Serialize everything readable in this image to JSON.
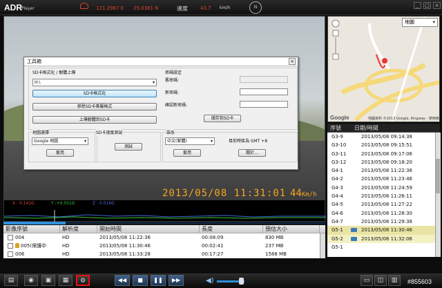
{
  "app": {
    "logo": "ADR",
    "logo_sub": "Player"
  },
  "status": {
    "longitude": "121.2967 E",
    "latitude": "25.0381 N",
    "speed_label": "速度",
    "speed_value": "43.7",
    "speed_unit": "km/h",
    "compass_label": "N"
  },
  "window_buttons": [
    "_",
    "□",
    "×"
  ],
  "video": {
    "timestamp": "2013/05/08  11:31:01",
    "speed": "44",
    "speed_unit": "Km/h"
  },
  "map": {
    "type_select": "地圖",
    "brand": "Google",
    "copyright": "地圖資料 ©2013 Google, Kingway - 使用條款"
  },
  "gps_list": {
    "headers": [
      "序號",
      "日期/時間"
    ],
    "rows": [
      {
        "id": "G3-9",
        "time": "2013/05/08 09:14:38"
      },
      {
        "id": "G3-10",
        "time": "2013/05/08 09:15:51"
      },
      {
        "id": "G3-11",
        "time": "2013/05/08 09:17:06"
      },
      {
        "id": "G3-12",
        "time": "2013/05/08 09:18:20"
      },
      {
        "id": "G4-1",
        "time": "2013/05/08 11:22:36"
      },
      {
        "id": "G4-2",
        "time": "2013/05/08 11:23:46"
      },
      {
        "id": "G4-3",
        "time": "2013/05/08 11:24:59"
      },
      {
        "id": "G4-4",
        "time": "2013/05/08 11:26:11"
      },
      {
        "id": "G4-5",
        "time": "2013/05/08 11:27:22"
      },
      {
        "id": "G4-6",
        "time": "2013/05/08 11:28:30"
      },
      {
        "id": "G4-7",
        "time": "2013/05/08 11:29:38"
      },
      {
        "id": "G5-1",
        "time": "2013/05/08 11:30:46"
      },
      {
        "id": "G5-2",
        "time": "2013/05/08 11:32:06"
      },
      {
        "id": "G5-1",
        "time": ""
      }
    ]
  },
  "gsensor": {
    "x": "X : 0.141G",
    "y": "Y :+0.031G",
    "z": "Z : 0.016G"
  },
  "files": {
    "headers": [
      "影像序號",
      "解析度",
      "開始時間",
      "長度",
      "預估大小"
    ],
    "rows": [
      {
        "id": "004",
        "res": "HD",
        "start": "2013/05/08 11:22:36",
        "len": "00:08:09",
        "size": "830 MB"
      },
      {
        "id": "005(保護中",
        "res": "HD",
        "start": "2013/05/08 11:30:46",
        "len": "00:02:41",
        "size": "237 MB"
      },
      {
        "id": "006",
        "res": "HD",
        "start": "2013/05/08 11:33:28",
        "len": "00:17:27",
        "size": "1588 MB"
      }
    ]
  },
  "controls": {
    "rewind": "◀◀",
    "stop": "■",
    "pause": "❚❚",
    "forward": "▶▶"
  },
  "watermark": "#855603",
  "dialog": {
    "title": "工具箱",
    "close": "×",
    "sd_section": "SD卡格式化 / 韌體上傳",
    "drive_select": "H:\\",
    "format_button": "SD卡格式化",
    "remove_button": "移除SD卡專屬格式",
    "upload_button": "上傳韌體到SD卡",
    "password_section": "密碼設定",
    "old_password": "舊密碼:",
    "new_password": "新密碼:",
    "confirm_password": "確認新密碼:",
    "save_password": "儲存到SD卡",
    "map_section": "地圖選擇",
    "map_select": "Google 地圖",
    "map_apply": "套用",
    "speed_test_section": "SD卡速度測試",
    "test_button": "測試",
    "lang_section": "語系",
    "lang_select": "中文(繁體)",
    "lang_apply": "套用",
    "timezone": "目前時區為 GMT +8",
    "about_button": "關於..."
  }
}
